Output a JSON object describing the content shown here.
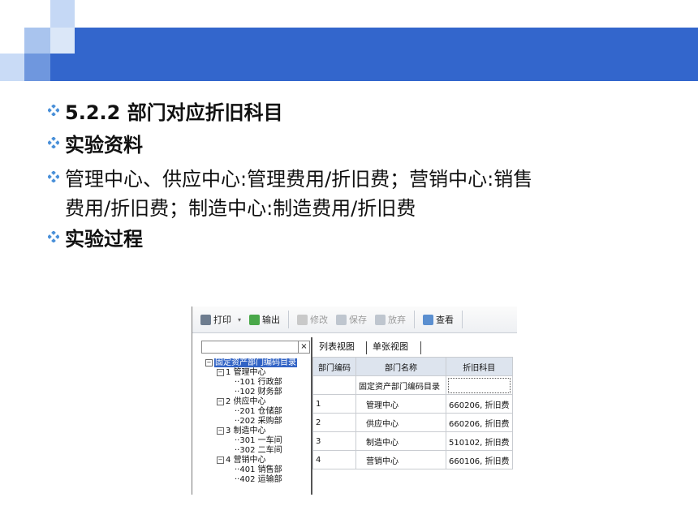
{
  "colors": {
    "header_bar": "#3366cc",
    "bullet_marker": "#4a90d9",
    "selection": "#3163c5"
  },
  "bullets": [
    {
      "text": "5.2.2 部门对应折旧科目",
      "bold": true
    },
    {
      "text": "实验资料",
      "bold": true
    },
    {
      "text": "管理中心、供应中心:管理费用/折旧费；营销中心:销售",
      "bold": false
    },
    {
      "text": "费用/折旧费；制造中心:制造费用/折旧费",
      "bold": false,
      "continuation": true
    },
    {
      "text": "实验过程",
      "bold": true
    }
  ],
  "toolbar": {
    "print": "打印",
    "export": "输出",
    "edit": "修改",
    "save": "保存",
    "discard": "放弃",
    "view": "查看",
    "icons": {
      "print": "printer-icon",
      "export": "export-icon",
      "edit": "pencil-icon",
      "save": "disk-icon",
      "discard": "discard-icon",
      "view": "magnifier-icon"
    }
  },
  "search": {
    "clear": "×",
    "value": ""
  },
  "tree": {
    "root": "固定资产部门编码目录",
    "nodes": [
      {
        "code": "1",
        "name": "管理中心",
        "children": [
          {
            "code": "101",
            "name": "行政部"
          },
          {
            "code": "102",
            "name": "财务部"
          }
        ]
      },
      {
        "code": "2",
        "name": "供应中心",
        "children": [
          {
            "code": "201",
            "name": "仓储部"
          },
          {
            "code": "202",
            "name": "采购部"
          }
        ]
      },
      {
        "code": "3",
        "name": "制造中心",
        "children": [
          {
            "code": "301",
            "name": "一车间"
          },
          {
            "code": "302",
            "name": "二车间"
          }
        ]
      },
      {
        "code": "4",
        "name": "营销中心",
        "children": [
          {
            "code": "401",
            "name": "销售部"
          },
          {
            "code": "402",
            "name": "运输部"
          }
        ]
      }
    ]
  },
  "tabs": {
    "list": "列表视图",
    "single": "单张视图"
  },
  "table": {
    "headers": [
      "部门编码",
      "部门名称",
      "折旧科目"
    ],
    "rows": [
      [
        "",
        "固定资产部门编码目录",
        ""
      ],
      [
        "1",
        "管理中心",
        "660206, 折旧费"
      ],
      [
        "2",
        "供应中心",
        "660206, 折旧费"
      ],
      [
        "3",
        "制造中心",
        "510102, 折旧费"
      ],
      [
        "4",
        "营销中心",
        "660106, 折旧费"
      ]
    ]
  }
}
